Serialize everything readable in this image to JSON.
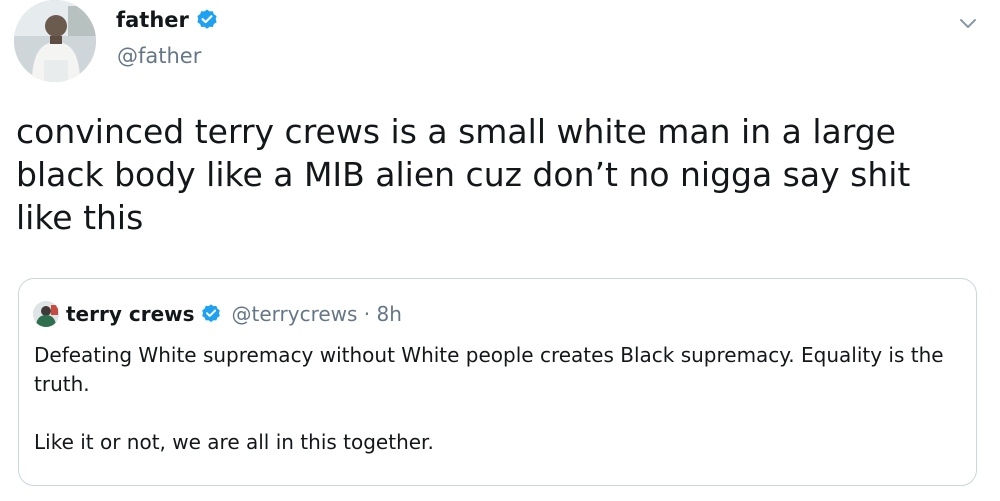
{
  "tweet": {
    "author": {
      "display_name": "father",
      "handle": "@father",
      "verified": true,
      "avatar_icon": "person-avatar"
    },
    "menu_icon": "chevron-down-icon",
    "text": "convinced terry crews is a small white man in a large black body like a MIB alien cuz don’t no nigga say shit like this",
    "quoted_tweet": {
      "author": {
        "display_name": "terry crews",
        "handle": "@terrycrews",
        "verified": true,
        "avatar_icon": "person-avatar"
      },
      "separator": " · ",
      "time": "8h",
      "paragraphs": [
        "Defeating White supremacy without White people creates Black supremacy. Equality is the truth.",
        "Like it or not, we are all in this together."
      ]
    }
  },
  "colors": {
    "verified_blue": "#1da1f2",
    "text_primary": "#14171a",
    "text_secondary": "#657786",
    "border": "#ccd6dd"
  }
}
